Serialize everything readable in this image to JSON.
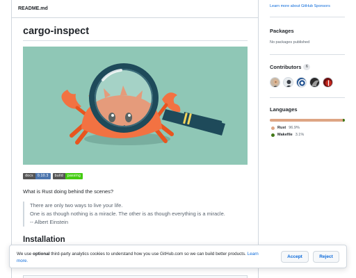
{
  "readme": {
    "filename": "README.md",
    "title": "cargo-inspect",
    "badges": [
      {
        "key": "docs",
        "value": "0.10.3",
        "color": "#4d76ae"
      },
      {
        "key": "build",
        "value": "passing",
        "color": "#44cc11"
      }
    ],
    "question": "What is Rust doing behind the scenes?",
    "quote_lines": [
      "There are only two ways to live your life.",
      "One is as though nothing is a miracle. The other is as though everything is a miracle.",
      "-- Albert Einstein"
    ],
    "install_heading": "Installation"
  },
  "sidebar": {
    "sponsors_link": "Learn more about GitHub Sponsors",
    "packages": {
      "heading": "Packages",
      "text": "No packages published"
    },
    "contributors": {
      "heading": "Contributors",
      "count": "6"
    },
    "languages": {
      "heading": "Languages",
      "items": [
        {
          "name": "Rust",
          "percent": "96.9%",
          "color": "#dea584",
          "share": 0.969
        },
        {
          "name": "Makefile",
          "percent": "3.1%",
          "color": "#427819",
          "share": 0.031
        }
      ]
    }
  },
  "cookie": {
    "text_before": "We use ",
    "emphasis": "optional",
    "text_after": " third-party analytics cookies to understand how you use GitHub.com so we can build better products. ",
    "link": "Learn more.",
    "accept": "Accept",
    "reject": "Reject"
  }
}
